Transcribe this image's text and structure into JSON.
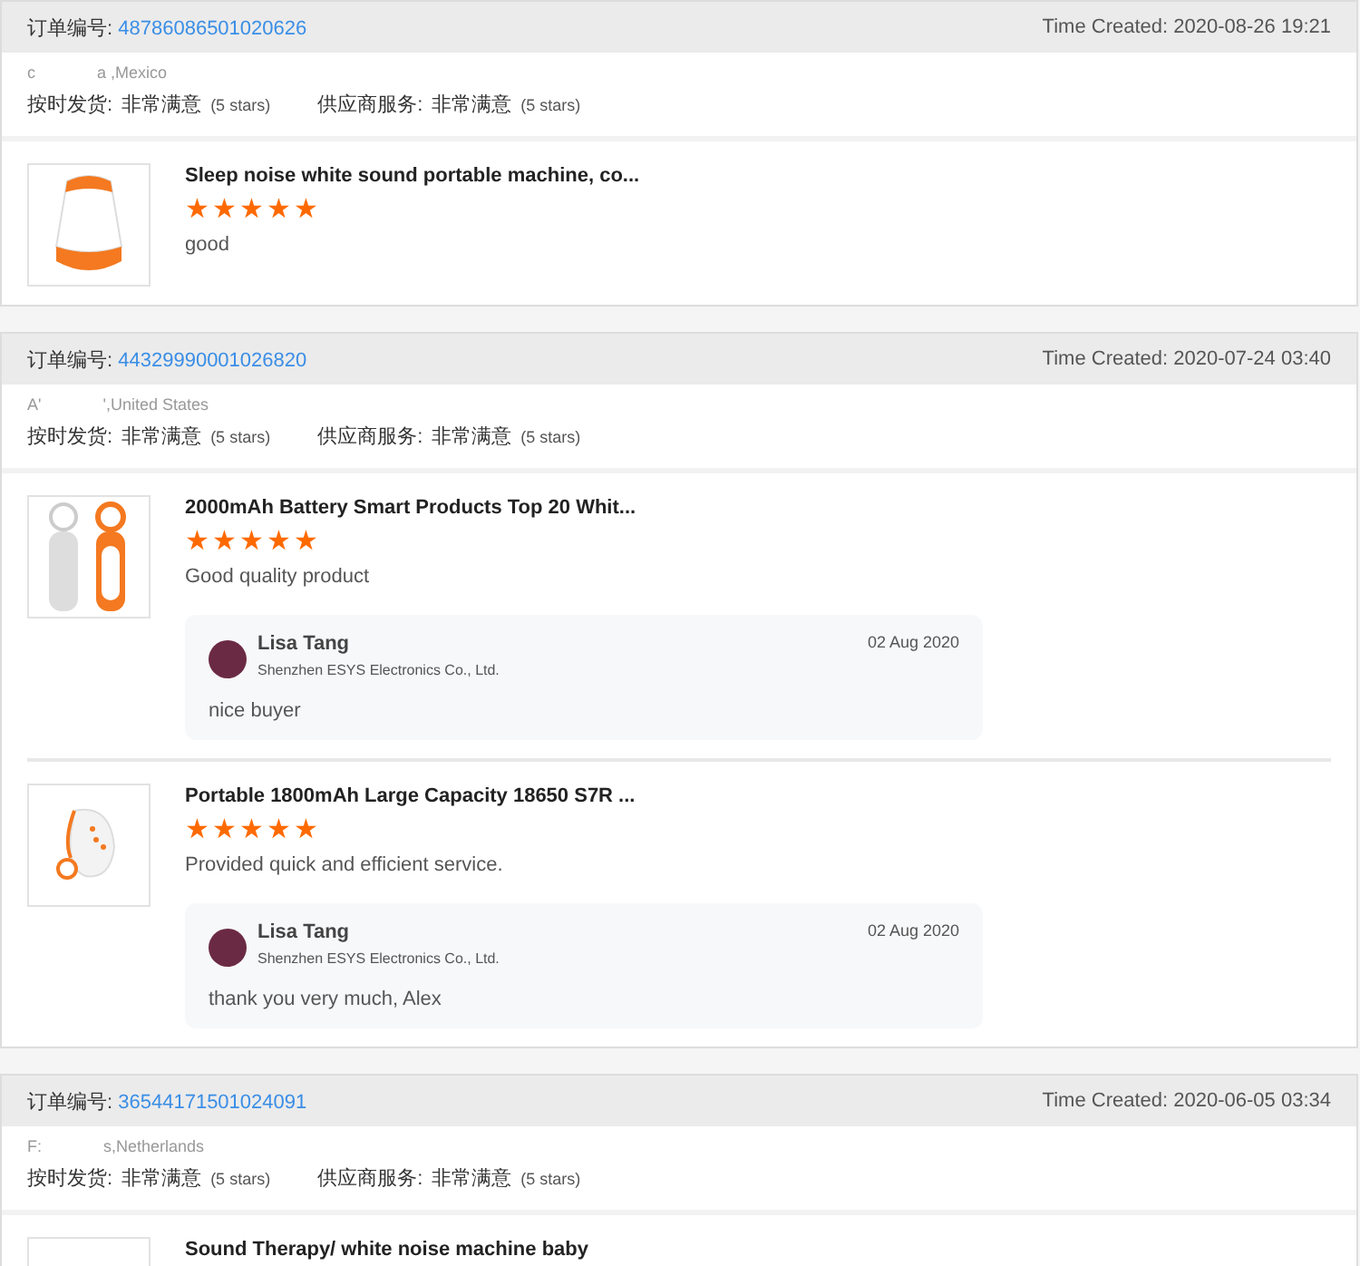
{
  "orders": [
    {
      "order_label": "订单编号:",
      "order_number": "48786086501020626",
      "time_created": "Time Created: 2020-08-26 19:21",
      "buyer_initial": "c",
      "buyer_location": "a ,Mexico",
      "ratings": [
        {
          "label": "按时发货:",
          "value": "非常满意",
          "note": "(5 stars)"
        },
        {
          "label": "供应商服务:",
          "value": "非常满意",
          "note": "(5 stars)"
        }
      ],
      "products": [
        {
          "kind": "speaker",
          "title": "Sleep noise white sound portable machine, co...",
          "stars": 5,
          "review": "good"
        }
      ]
    },
    {
      "order_label": "订单编号:",
      "order_number": "44329990001026820",
      "time_created": "Time Created: 2020-07-24 03:40",
      "buyer_initial": "A'",
      "buyer_location": "',United States",
      "ratings": [
        {
          "label": "按时发货:",
          "value": "非常满意",
          "note": "(5 stars)"
        },
        {
          "label": "供应商服务:",
          "value": "非常满意",
          "note": "(5 stars)"
        }
      ],
      "products": [
        {
          "kind": "keychain",
          "title": "2000mAh Battery Smart Products Top 20 Whit...",
          "stars": 5,
          "review": "Good quality product",
          "reply": {
            "name": "Lisa Tang",
            "company": "Shenzhen ESYS Electronics Co., Ltd.",
            "date": "02 Aug 2020",
            "text": "nice buyer"
          }
        },
        {
          "kind": "clip",
          "title": "Portable 1800mAh Large Capacity 18650 S7R ...",
          "stars": 5,
          "review": "Provided quick and efficient service.",
          "reply": {
            "name": "Lisa Tang",
            "company": "Shenzhen ESYS Electronics Co., Ltd.",
            "date": "02 Aug 2020",
            "text": "thank you very much, Alex"
          }
        }
      ]
    },
    {
      "order_label": "订单编号:",
      "order_number": "36544171501024091",
      "time_created": "Time Created: 2020-06-05 03:34",
      "buyer_initial": "F:",
      "buyer_location": "s,Netherlands",
      "ratings": [
        {
          "label": "按时发货:",
          "value": "非常满意",
          "note": "(5 stars)"
        },
        {
          "label": "供应商服务:",
          "value": "非常满意",
          "note": "(5 stars)"
        }
      ],
      "products": [
        {
          "kind": "blank",
          "title": "Sound Therapy/ white noise machine baby"
        }
      ]
    }
  ]
}
